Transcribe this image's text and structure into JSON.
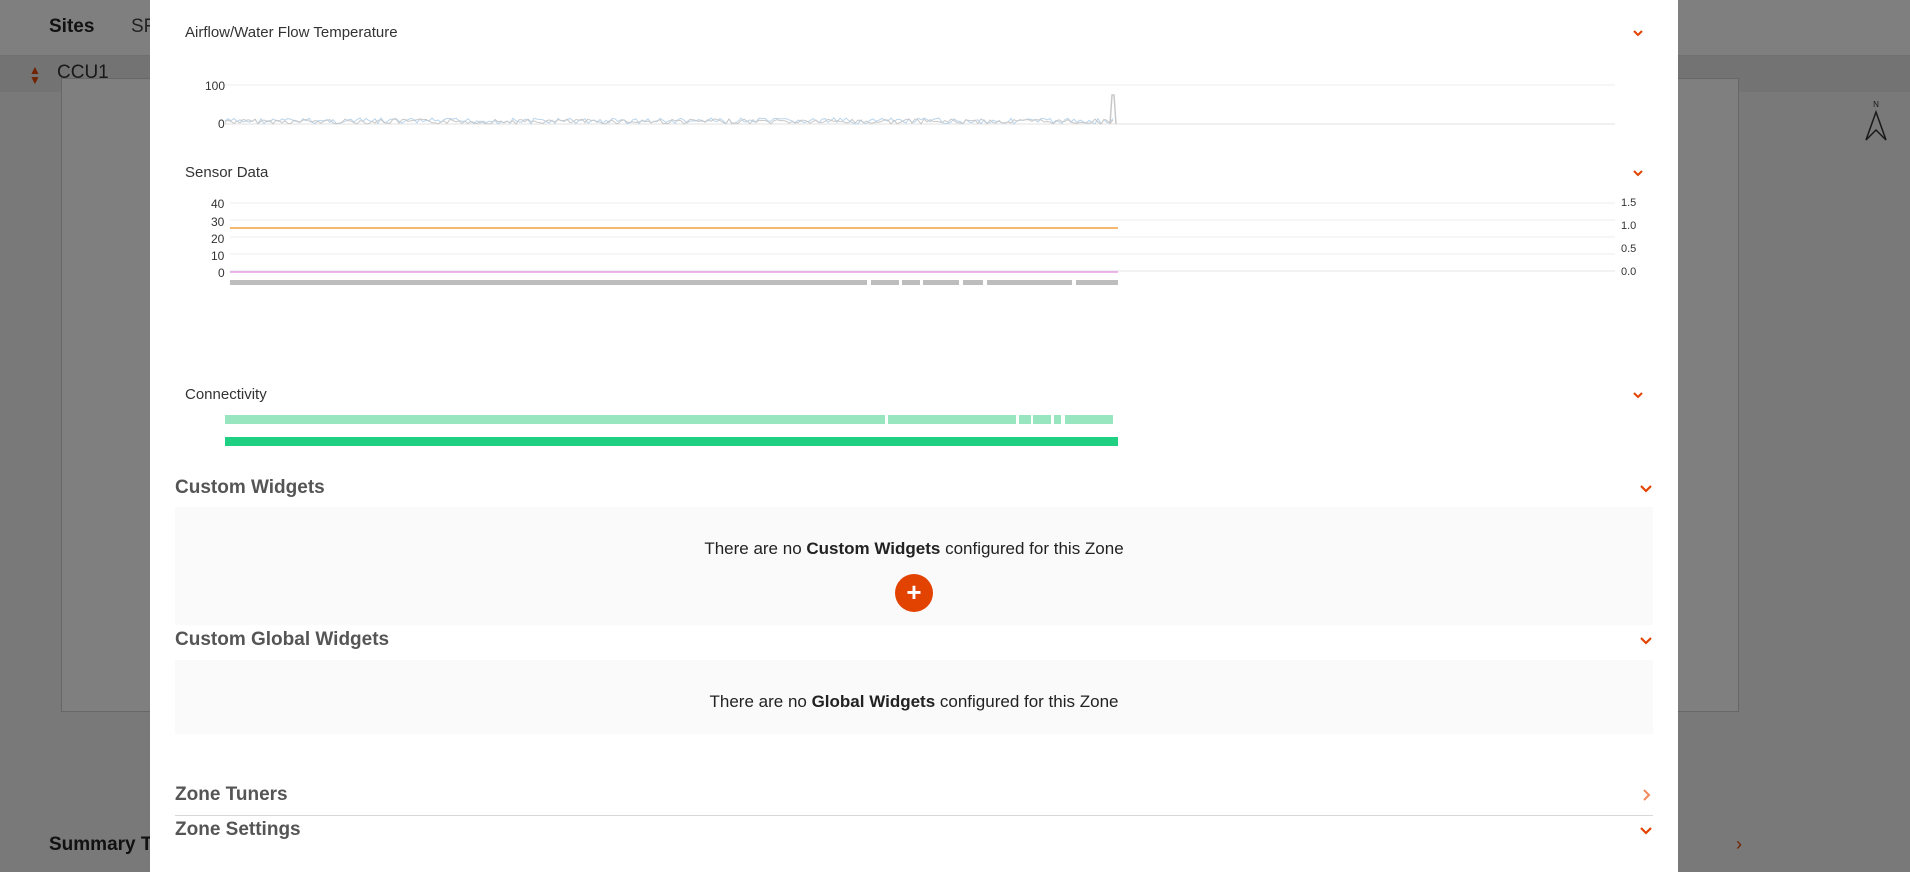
{
  "background": {
    "nav": {
      "sites": "Sites",
      "tab2": "SF"
    },
    "ccu": {
      "name": "CCU1"
    },
    "summary": "Summary T",
    "compass_label": "N"
  },
  "modal": {
    "airflow": {
      "title": "Airflow/Water Flow Temperature",
      "y_ticks": [
        "100",
        "0"
      ]
    },
    "sensor": {
      "title": "Sensor Data",
      "left_ticks": [
        "40",
        "30",
        "20",
        "10",
        "0"
      ],
      "right_ticks": [
        "1.5",
        "1.0",
        "0.5",
        "0.0"
      ]
    },
    "connectivity": {
      "title": "Connectivity"
    },
    "custom_widgets": {
      "title": "Custom Widgets",
      "empty_pre": "There are no ",
      "empty_bold": "Custom Widgets",
      "empty_post": " configured for this Zone",
      "add_label": "+"
    },
    "global_widgets": {
      "title": "Custom Global Widgets",
      "empty_pre": "There are no ",
      "empty_bold": "Global Widgets",
      "empty_post": " configured for this Zone"
    },
    "zone_tuners": {
      "title": "Zone Tuners"
    },
    "zone_settings": {
      "title": "Zone Settings"
    }
  },
  "colors": {
    "accent": "#e24301",
    "orange_line": "#f0a040",
    "pink_line": "#e8a0e8",
    "conn_light": "#98e6c0",
    "conn_dark": "#1fcf82",
    "gray_bar": "#bdbdbd",
    "light_blue": "#b8d4ec"
  },
  "icons": {
    "chevron_down": "chevron-down-icon",
    "chevron_right": "chevron-right-icon",
    "plus": "plus-icon",
    "compass": "compass-icon",
    "updown": "up-down-chevrons-icon"
  }
}
